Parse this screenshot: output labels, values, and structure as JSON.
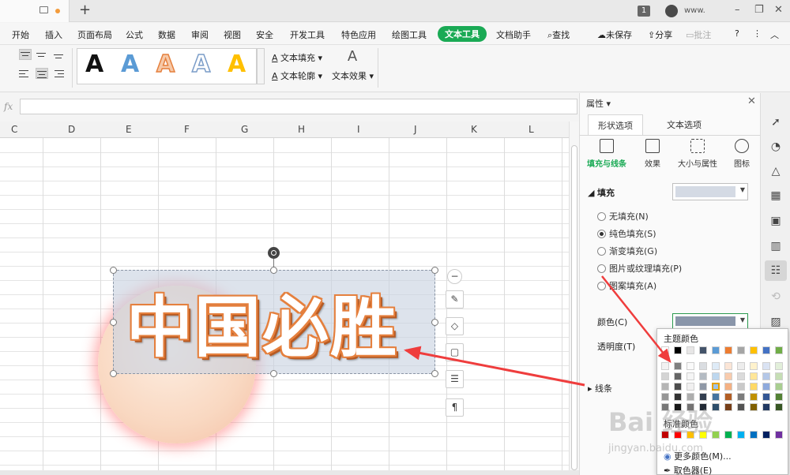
{
  "window": {
    "badge": "1",
    "user": "www.",
    "minimize": "–",
    "restore": "❐",
    "close": "✕",
    "new_tab": "+"
  },
  "menus": [
    "开始",
    "插入",
    "页面布局",
    "公式",
    "数据",
    "审阅",
    "视图",
    "安全",
    "开发工具",
    "特色应用",
    "绘图工具",
    "文本工具",
    "文档助手",
    "查找"
  ],
  "menu_active": "文本工具",
  "menu_right": {
    "save": "未保存",
    "share": "分享",
    "comment": "批注",
    "help": "?",
    "more": "⋮"
  },
  "ribbon": {
    "style_letter": "A",
    "text_fill": "文本填充",
    "text_outline": "文本轮廓",
    "text_effect": "文本效果"
  },
  "formula": {
    "fx": "fx"
  },
  "columns": [
    "C",
    "D",
    "E",
    "F",
    "G",
    "H",
    "I",
    "J",
    "K",
    "L"
  ],
  "wordart": {
    "text": "中国必胜"
  },
  "panel": {
    "title": "属性",
    "tabs": [
      "形状选项",
      "文本选项"
    ],
    "subtabs": [
      "填充与线条",
      "效果",
      "大小与属性",
      "图标"
    ],
    "fill_section": "填充",
    "fill_options": [
      "无填充(N)",
      "纯色填充(S)",
      "渐变填充(G)",
      "图片或纹理填充(P)",
      "图案填充(A)"
    ],
    "color_label": "颜色(C)",
    "transparency_label": "透明度(T)",
    "line_section": "线条"
  },
  "palette": {
    "theme_label": "主题颜色",
    "standard_label": "标准颜色",
    "more_colors": "更多颜色(M)...",
    "eyedropper": "取色器(E)",
    "theme_top": [
      "#ffffff",
      "#000000",
      "#e7e6e6",
      "#44546a",
      "#5b9bd5",
      "#ed7d31",
      "#a5a5a5",
      "#ffc000",
      "#4472c4",
      "#70ad47"
    ],
    "standard": [
      "#c00000",
      "#ff0000",
      "#ffc000",
      "#ffff00",
      "#92d050",
      "#00b050",
      "#00b0f0",
      "#0070c0",
      "#002060",
      "#7030a0"
    ]
  },
  "watermark": {
    "brand": "Bai 经验",
    "url": "jingyan.baidu.com"
  },
  "colors": {
    "accent": "#1aaa55",
    "wordart_outline": "#e5803e",
    "swatch": "#8a96aa"
  }
}
